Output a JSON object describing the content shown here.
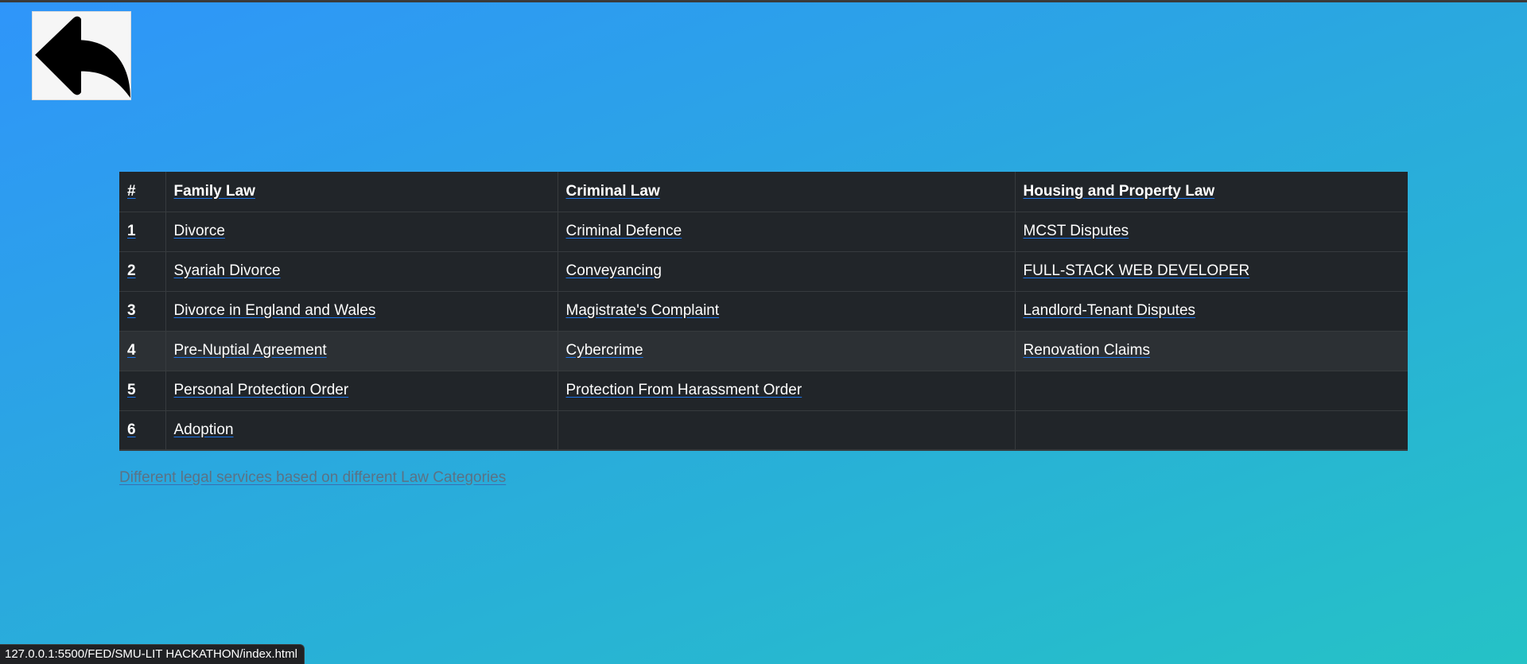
{
  "back_button": {
    "icon": "reply-arrow-icon"
  },
  "table": {
    "headers": [
      "#",
      "Family Law",
      "Criminal Law",
      "Housing and Property Law"
    ],
    "rows": [
      {
        "num": "1",
        "family": "Divorce",
        "criminal": "Criminal Defence",
        "housing": "MCST Disputes"
      },
      {
        "num": "2",
        "family": "Syariah Divorce",
        "criminal": "Conveyancing",
        "housing": "FULL-STACK WEB DEVELOPER"
      },
      {
        "num": "3",
        "family": "Divorce in England and Wales",
        "criminal": "Magistrate's Complaint",
        "housing": "Landlord-Tenant Disputes"
      },
      {
        "num": "4",
        "family": "Pre-Nuptial Agreement",
        "criminal": "Cybercrime",
        "housing": "Renovation Claims"
      },
      {
        "num": "5",
        "family": "Personal Protection Order",
        "criminal": "Protection From Harassment Order",
        "housing": ""
      },
      {
        "num": "6",
        "family": "Adoption",
        "criminal": "",
        "housing": ""
      }
    ],
    "caption": "Different legal services based on different Law Categories"
  },
  "status_bar": {
    "url": "127.0.0.1:5500/FED/SMU-LIT HACKATHON/index.html"
  },
  "colors": {
    "background_start": "#2f95fa",
    "background_end": "#25c2c6",
    "table_bg": "#212529",
    "row_hover_bg": "#2c3034",
    "link_underline": "#1a73e8"
  }
}
